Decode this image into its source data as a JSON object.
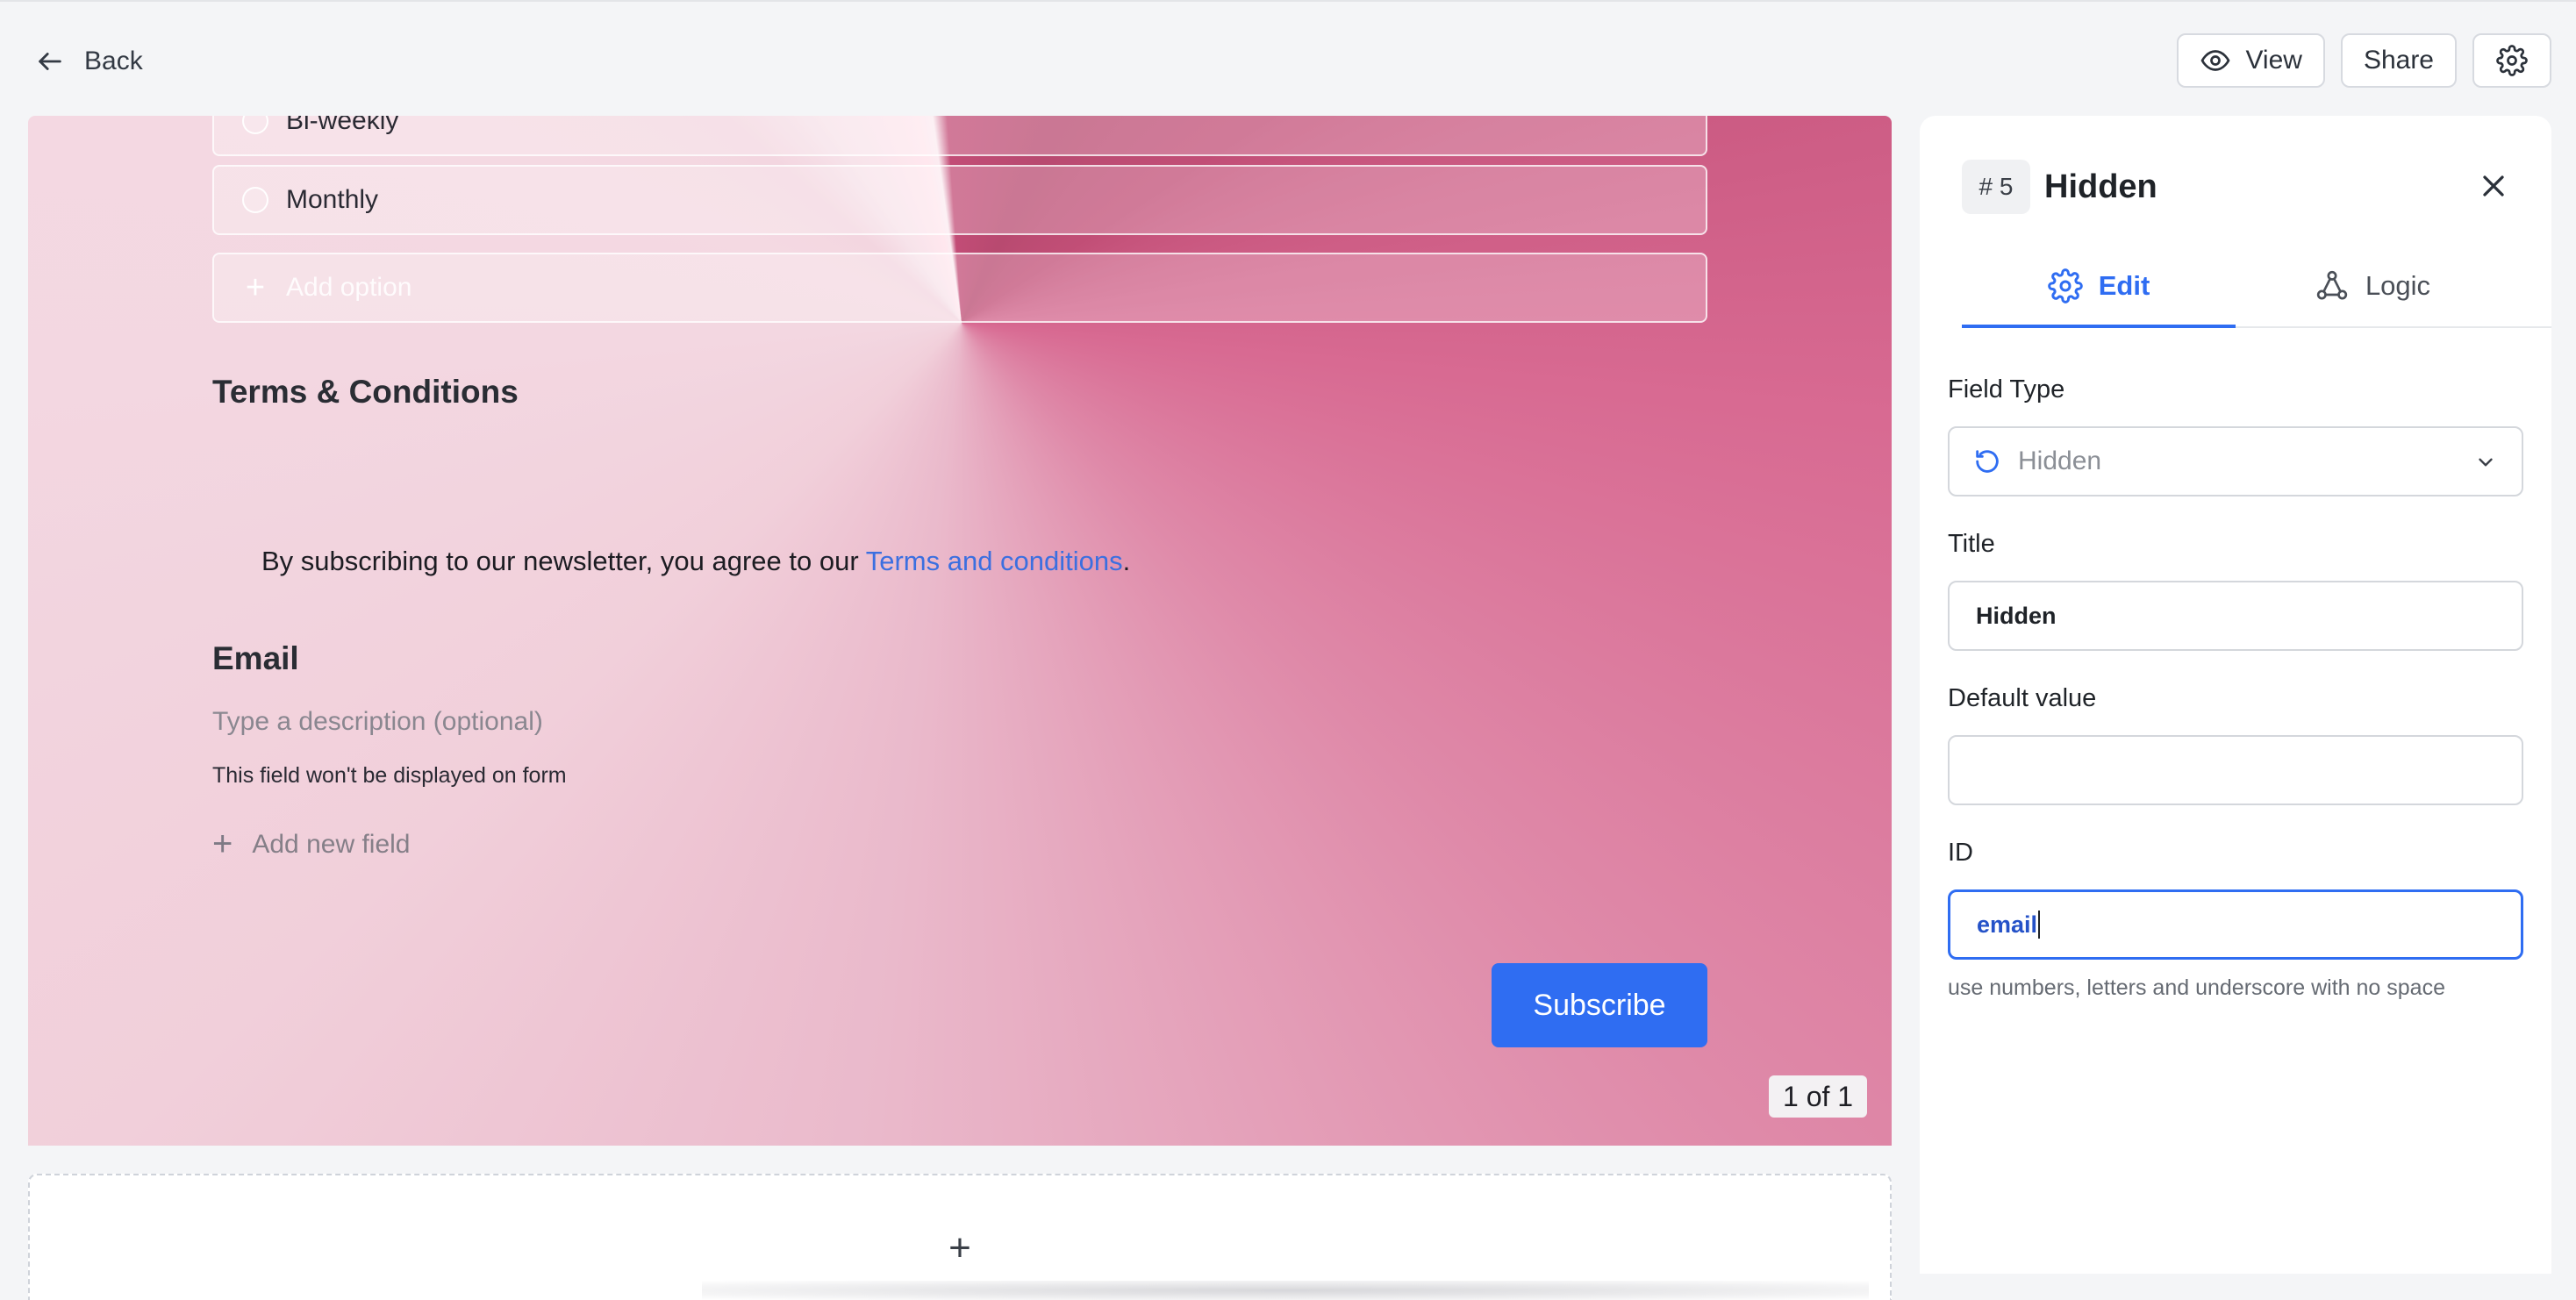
{
  "topbar": {
    "back_label": "Back",
    "view_label": "View",
    "share_label": "Share"
  },
  "form": {
    "options": [
      "Bi-weekly",
      "Monthly"
    ],
    "add_option_placeholder": "Add option",
    "terms_title": "Terms & Conditions",
    "terms_text": "By subscribing to our newsletter, you agree to our ",
    "terms_link": "Terms and conditions",
    "terms_end": ".",
    "email_title": "Email",
    "email_description_placeholder": "Type a description (optional)",
    "hidden_note": "This field won't be displayed on form",
    "add_new_field": "Add new field",
    "submit_label": "Subscribe",
    "pager": "1 of 1",
    "add_block_symbol": "+"
  },
  "panel": {
    "field_number": "# 5",
    "title": "Hidden",
    "tabs": [
      {
        "label": "Edit",
        "active": true,
        "icon": "gear-icon"
      },
      {
        "label": "Logic",
        "active": false,
        "icon": "logic-icon"
      }
    ],
    "field_type_label": "Field Type",
    "field_type_value": "Hidden",
    "title_label": "Title",
    "title_value": "Hidden",
    "default_value_label": "Default value",
    "default_value": "",
    "id_label": "ID",
    "id_value": "email",
    "id_help": "use numbers, letters and underscore with no space"
  },
  "colors": {
    "accent": "#2f6df2",
    "canvas_dark": "#c14e76",
    "canvas_light": "#f4d9e2"
  }
}
